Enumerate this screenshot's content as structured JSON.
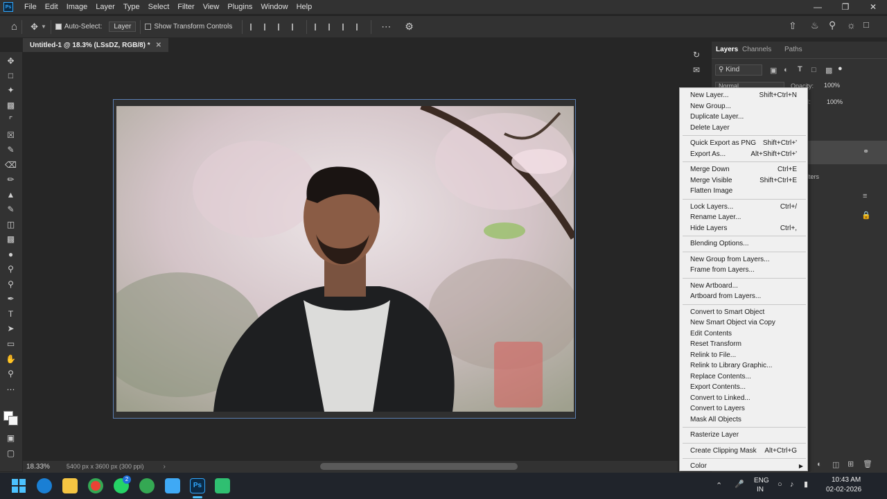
{
  "menubar": {
    "items": [
      "File",
      "Edit",
      "Image",
      "Layer",
      "Type",
      "Select",
      "Filter",
      "View",
      "Plugins",
      "Window",
      "Help"
    ]
  },
  "options": {
    "auto_select_label": "Auto-Select:",
    "auto_select_value": "Layer",
    "show_transform_label": "Show Transform Controls"
  },
  "document": {
    "tab_title": "Untitled-1 @ 18.3% (LSsDZ, RGB/8) *"
  },
  "status": {
    "zoom": "18.33%",
    "doc_size": "5400 px x 3600 px (300 ppi)"
  },
  "layers_panel": {
    "tabs": [
      "Layers",
      "Channels",
      "Paths"
    ],
    "filter_kind": "Kind",
    "blend_mode": "Normal",
    "opacity_label": "Opacity:",
    "opacity_value": "100%",
    "fill_label": "ll:",
    "fill_value": "100%",
    "partial_text": "lters"
  },
  "context_menu": {
    "groups": [
      [
        {
          "label": "New Layer...",
          "shortcut": "Shift+Ctrl+N"
        },
        {
          "label": "New Group...",
          "shortcut": ""
        },
        {
          "label": "Duplicate Layer...",
          "shortcut": ""
        },
        {
          "label": "Delete Layer",
          "shortcut": ""
        }
      ],
      [
        {
          "label": "Quick Export as PNG",
          "shortcut": "Shift+Ctrl+'"
        },
        {
          "label": "Export As...",
          "shortcut": "Alt+Shift+Ctrl+'"
        }
      ],
      [
        {
          "label": "Merge Down",
          "shortcut": "Ctrl+E"
        },
        {
          "label": "Merge Visible",
          "shortcut": "Shift+Ctrl+E"
        },
        {
          "label": "Flatten Image",
          "shortcut": ""
        }
      ],
      [
        {
          "label": "Lock Layers...",
          "shortcut": "Ctrl+/"
        },
        {
          "label": "Rename Layer...",
          "shortcut": ""
        },
        {
          "label": "Hide Layers",
          "shortcut": "Ctrl+,"
        }
      ],
      [
        {
          "label": "Blending Options...",
          "shortcut": ""
        }
      ],
      [
        {
          "label": "New Group from Layers...",
          "shortcut": ""
        },
        {
          "label": "Frame from Layers...",
          "shortcut": ""
        }
      ],
      [
        {
          "label": "New Artboard...",
          "shortcut": ""
        },
        {
          "label": "Artboard from Layers...",
          "shortcut": ""
        }
      ],
      [
        {
          "label": "Convert to Smart Object",
          "shortcut": ""
        },
        {
          "label": "New Smart Object via Copy",
          "shortcut": ""
        },
        {
          "label": "Edit Contents",
          "shortcut": ""
        },
        {
          "label": "Reset Transform",
          "shortcut": ""
        },
        {
          "label": "Relink to File...",
          "shortcut": ""
        },
        {
          "label": "Relink to Library Graphic...",
          "shortcut": ""
        },
        {
          "label": "Replace Contents...",
          "shortcut": ""
        },
        {
          "label": "Export Contents...",
          "shortcut": ""
        },
        {
          "label": "Convert to Linked...",
          "shortcut": ""
        },
        {
          "label": "Convert to Layers",
          "shortcut": ""
        },
        {
          "label": "Mask All Objects",
          "shortcut": ""
        }
      ],
      [
        {
          "label": "Rasterize Layer",
          "shortcut": ""
        }
      ],
      [
        {
          "label": "Create Clipping Mask",
          "shortcut": "Alt+Ctrl+G"
        }
      ],
      [
        {
          "label": "Color",
          "shortcut": "",
          "submenu": true
        }
      ]
    ]
  },
  "taskbar": {
    "lang_top": "ENG",
    "lang_bottom": "IN",
    "time": "10:43 AM",
    "date": "02-02-2026",
    "whatsapp_badge": "2"
  },
  "colors": {
    "accent": "#31a8ff",
    "menu_bg": "#f0f0f0",
    "app_bg": "#323232"
  }
}
